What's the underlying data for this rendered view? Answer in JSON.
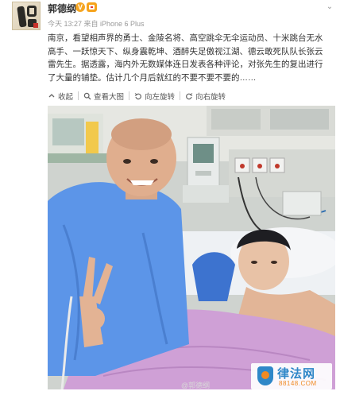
{
  "post": {
    "user_name": "郭德纲",
    "verified_icon": "V",
    "meta": "今天 13:27 来自 iPhone 6 Plus",
    "more_icon": "chevron-down-icon",
    "text": "南京，看望相声界的勇士、金陵名将、高空跳伞无伞运动员、十米跳台无水高手、一跃惊天下、纵身震乾坤、酒醉失足傲视江湖、德云敢死队队长张云雷先生。据透露，海内外无数媒体连日发表各种评论，对张先生的复出进行了大量的铺垫。估计几个月后就红的不要不要不要的……"
  },
  "actions": {
    "collapse": "收起",
    "view_large": "查看大图",
    "rotate_left": "向左旋转",
    "rotate_right": "向右旋转"
  },
  "image": {
    "watermark": "@郭德纲",
    "badge_name": "律法网",
    "badge_url": "88148.COM"
  },
  "colors": {
    "link": "#333333",
    "meta": "#999999",
    "badge_blue": "#2f87c8",
    "badge_orange": "#f08a24"
  }
}
